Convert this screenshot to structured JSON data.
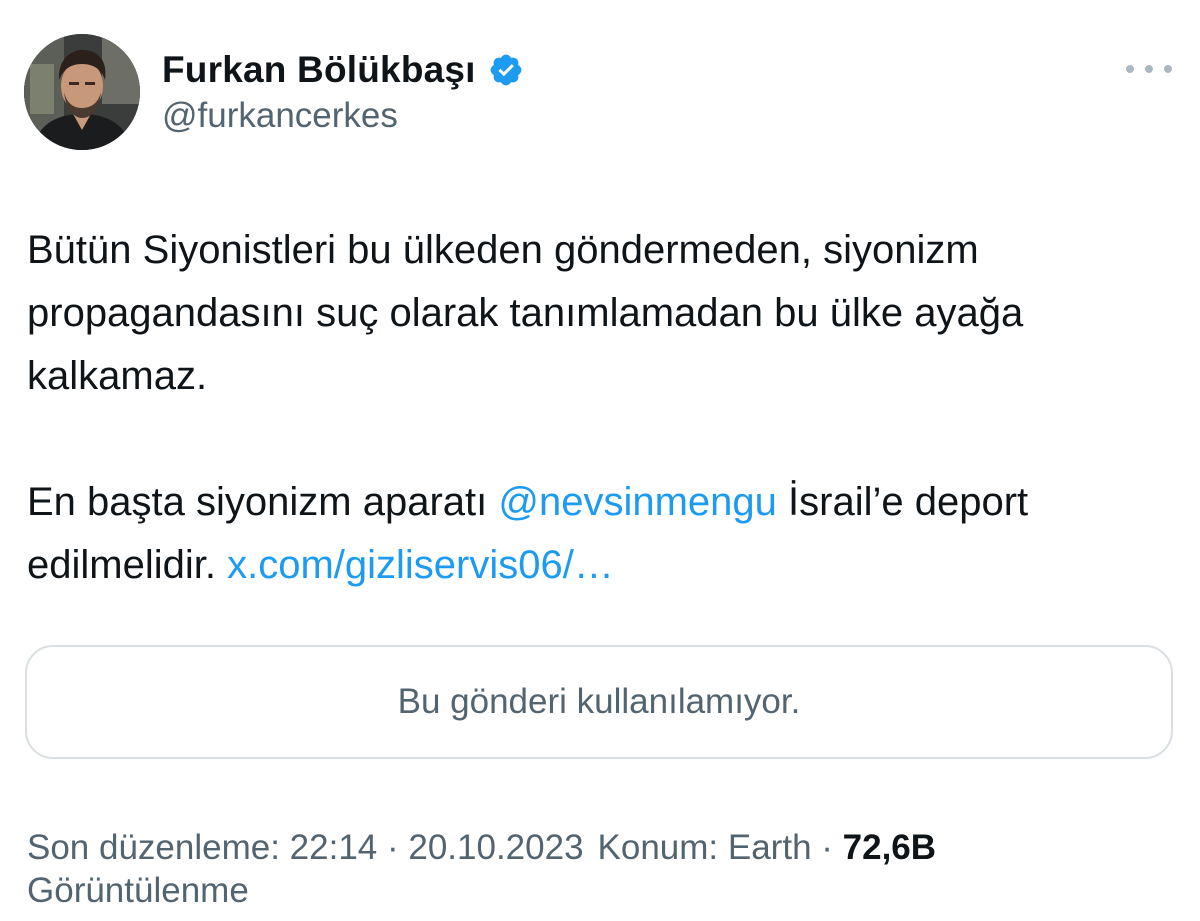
{
  "author": {
    "display_name": "Furkan Bölükbaşı",
    "handle": "@furkancerkes",
    "verified": true,
    "avatar_icon": "profile-photo",
    "verified_color": "#1d9bf0"
  },
  "tweet": {
    "para1": "Bütün Siyonistleri bu ülkeden göndermeden, siyonizm propagandasını suç olarak tanımlamadan bu ülke ayağa kalkamaz.",
    "para2_prefix": "En başta siyonizm aparatı ",
    "mention": "@nevsinmengu",
    "para2_middle": " İsrail’e deport edilmelidir. ",
    "link_text": "x.com/gizliservis06/…",
    "link_color": "#1d9bf0"
  },
  "quoted": {
    "unavailable_text": "Bu gönderi kullanılamıyor."
  },
  "meta": {
    "edited": "Son düzenleme: 22:14 · 20.10.2023",
    "location": "Konum: Earth ·",
    "views_count": "72,6B",
    "views_label": "Görüntülenme"
  },
  "colors": {
    "text_primary": "#0f1419",
    "text_secondary": "#536471",
    "border": "#d9dfe3"
  }
}
